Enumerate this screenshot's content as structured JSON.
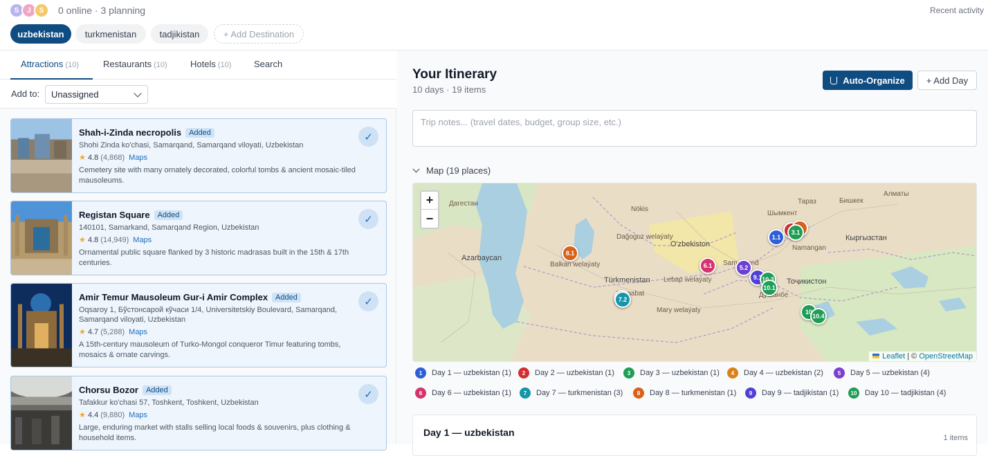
{
  "presence": {
    "avatars": [
      {
        "initial": "S",
        "color": "#b7b4f0"
      },
      {
        "initial": "J",
        "color": "#f0a6c4"
      },
      {
        "initial": "S",
        "color": "#f3c96a"
      }
    ],
    "status": "0 online · 3 planning",
    "recent_activity": "Recent activity"
  },
  "destinations": {
    "items": [
      "uzbekistan",
      "turkmenistan",
      "tadjikistan"
    ],
    "add_label": "+ Add Destination"
  },
  "tabs": [
    {
      "label": "Attractions",
      "count": "(10)"
    },
    {
      "label": "Restaurants",
      "count": "(10)"
    },
    {
      "label": "Hotels",
      "count": "(10)"
    },
    {
      "label": "Search",
      "count": ""
    }
  ],
  "add_to": {
    "label": "Add to:",
    "value": "Unassigned"
  },
  "attractions": [
    {
      "name": "Shah-i-Zinda necropolis",
      "badge": "Added",
      "address": "Shohi Zinda ko'chasi, Samarqand, Samarqand viloyati, Uzbekistan",
      "rating": "4.8",
      "reviews": "(4,868)",
      "maps": "Maps",
      "description": "Cemetery site with many ornately decorated, colorful tombs & ancient mosaic-tiled mausoleums."
    },
    {
      "name": "Registan Square",
      "badge": "Added",
      "address": "140101, Samarkand, Samarqand Region, Uzbekistan",
      "rating": "4.8",
      "reviews": "(14,949)",
      "maps": "Maps",
      "description": "Ornamental public square flanked by 3 historic madrasas built in the 15th & 17th centuries."
    },
    {
      "name": "Amir Temur Mausoleum Gur-i Amir Complex",
      "badge": "Added",
      "address": "Oqsaroy 1, Бўстонсарой кўчаси 1/4, Universitetskiy Boulevard, Samarqand, Samarqand viloyati, Uzbekistan",
      "rating": "4.7",
      "reviews": "(5,288)",
      "maps": "Maps",
      "description": "A 15th-century mausoleum of Turko-Mongol conqueror Timur featuring tombs, mosaics & ornate carvings."
    },
    {
      "name": "Chorsu Bozor",
      "badge": "Added",
      "address": "Tafakkur ko'chasi 57, Toshkent, Toshkent, Uzbekistan",
      "rating": "4.4",
      "reviews": "(9,880)",
      "maps": "Maps",
      "description": "Large, enduring market with stalls selling local foods & souvenirs, plus clothing & household items."
    }
  ],
  "itinerary": {
    "title": "Your Itinerary",
    "subtitle": "10 days · 19 items",
    "auto_organize": "Auto-Organize",
    "add_day": "+ Add Day",
    "notes_placeholder": "Trip notes... (travel dates, budget, group size, etc.)",
    "map_toggle": "Map (19 places)"
  },
  "map": {
    "zoom_in": "+",
    "zoom_out": "−",
    "attribution_leaflet": "Leaflet",
    "attribution_sep": " | © ",
    "attribution_osm": "OpenStreetMap",
    "labels": [
      "Azarbaycan",
      "Türkmenistan",
      "O'zbekiston",
      "Кыргызстан",
      "Тоҷикистон",
      "Samarqand",
      "Namangan",
      "Nökis",
      "Тараз",
      "Бишкек",
      "Алматы",
      "Шымкент",
      "Душанбе",
      "Dağoguz welaýaty",
      "Balkan welaýaty",
      "Lebap welaýaty",
      "Mary welaýaty",
      "Ashgabat",
      "Дагестан"
    ],
    "markers": [
      {
        "label": "1.1",
        "color": "#2f5fd6"
      },
      {
        "label": "3.1",
        "color": "#1f9d55"
      },
      {
        "label": "",
        "color": "#d9611a"
      },
      {
        "label": "",
        "color": "#d32f2f"
      },
      {
        "label": "8.1",
        "color": "#d9611a"
      },
      {
        "label": "6.1",
        "color": "#d6336c"
      },
      {
        "label": "5.2",
        "color": "#6c3fd1"
      },
      {
        "label": "9.1",
        "color": "#5140d6"
      },
      {
        "label": "10.3",
        "color": "#1f9d55"
      },
      {
        "label": "10.1",
        "color": "#1f9d55"
      },
      {
        "label": "",
        "color": "#1595a8"
      },
      {
        "label": "7.2",
        "color": "#1595a8"
      },
      {
        "label": "10",
        "color": "#1f9d55"
      },
      {
        "label": "10.4",
        "color": "#1f9d55"
      }
    ]
  },
  "legend": [
    {
      "num": "1",
      "label": "Day 1 — uzbekistan (1)",
      "color": "#2f5fd6"
    },
    {
      "num": "2",
      "label": "Day 2 — uzbekistan (1)",
      "color": "#d32f2f"
    },
    {
      "num": "3",
      "label": "Day 3 — uzbekistan (1)",
      "color": "#1f9d55"
    },
    {
      "num": "4",
      "label": "Day 4 — uzbekistan (2)",
      "color": "#d9821a"
    },
    {
      "num": "5",
      "label": "Day 5 — uzbekistan (4)",
      "color": "#7c3fd1"
    },
    {
      "num": "6",
      "label": "Day 6 — uzbekistan (1)",
      "color": "#d6336c"
    },
    {
      "num": "7",
      "label": "Day 7 — turkmenistan (3)",
      "color": "#1595a8"
    },
    {
      "num": "8",
      "label": "Day 8 — turkmenistan (1)",
      "color": "#d9611a"
    },
    {
      "num": "9",
      "label": "Day 9 — tadjikistan (1)",
      "color": "#5140d6"
    },
    {
      "num": "10",
      "label": "Day 10 — tadjikistan (4)",
      "color": "#1f9d55"
    }
  ],
  "day_card": {
    "title": "Day 1 — uzbekistan",
    "count": "1 items"
  },
  "icons": {
    "check": "checkmark-icon",
    "flask": "flask-icon",
    "chevron": "chevron-down-icon"
  }
}
